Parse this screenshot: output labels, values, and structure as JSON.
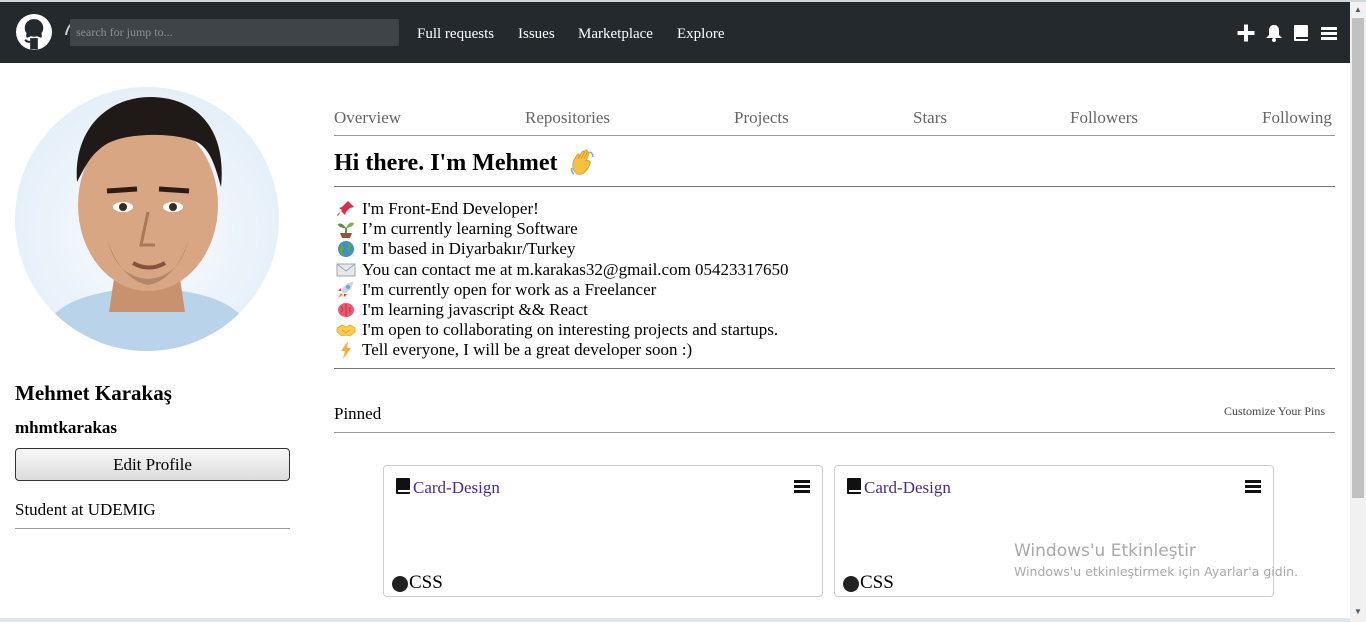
{
  "navbar": {
    "search_placeholder": "search for jump to...",
    "links": [
      "Full requests",
      "Issues",
      "Marketplace",
      "Explore"
    ],
    "icons": [
      "plus-icon",
      "bell-icon",
      "book-icon",
      "menu-icon"
    ]
  },
  "profile": {
    "full_name": "Mehmet Karakaş",
    "username": "mhmtkarakas",
    "edit_button": "Edit Profile",
    "bio": "Student at UDEMIG"
  },
  "tabs": [
    "Overview",
    "Repositories",
    "Projects",
    "Stars",
    "Followers",
    "Following"
  ],
  "readme": {
    "greeting": "Hi there. I'm Mehmet",
    "lines": [
      {
        "icon": "pushpin-icon",
        "text": "I'm Front-End Developer!"
      },
      {
        "icon": "seedling-icon",
        "text": "I’m currently learning Software"
      },
      {
        "icon": "globe-icon",
        "text": "I'm based in Diyarbakır/Turkey"
      },
      {
        "icon": "envelope-icon",
        "text": "You can contact me at m.karakas32@gmail.com 05423317650"
      },
      {
        "icon": "rocket-icon",
        "text": "I'm currently open for work as a Freelancer"
      },
      {
        "icon": "brain-icon",
        "text": "I'm learning javascript && React"
      },
      {
        "icon": "handshake-icon",
        "text": "I'm open to collaborating on interesting projects and startups."
      },
      {
        "icon": "lightning-icon",
        "text": "Tell everyone, I will be a great developer soon :)"
      }
    ]
  },
  "pinned": {
    "label": "Pinned",
    "customize": "Customize Your Pins",
    "cards": [
      {
        "title": "Card-Design",
        "language": "CSS"
      },
      {
        "title": "Card-Design",
        "language": "CSS"
      }
    ]
  },
  "watermark": {
    "title": "Windows'u Etkinleştir",
    "subtitle": "Windows'u etkinleştirmek için Ayarlar'a gidin."
  },
  "colors": {
    "navbar_bg": "#24292e",
    "repo_link": "#4b2a8b"
  }
}
